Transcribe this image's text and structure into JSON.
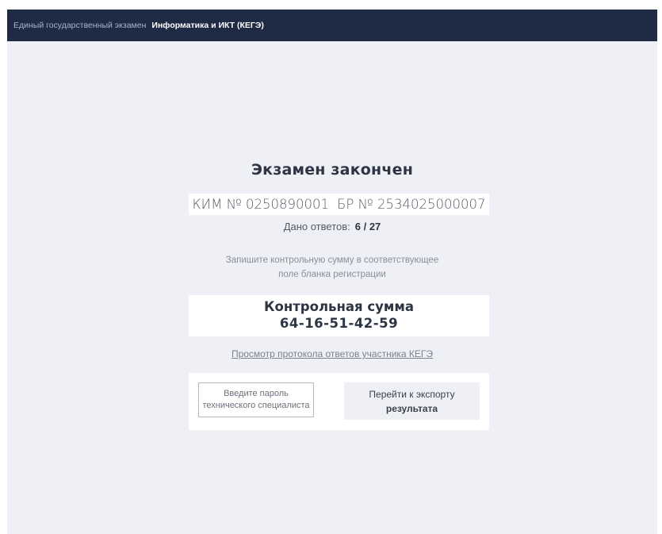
{
  "header": {
    "breadcrumb": "Единый государственный экзамен",
    "subject": "Информатика и ИКТ (КЕГЭ)"
  },
  "main": {
    "title": "Экзамен закончен",
    "kim": "КИМ № 0250890001",
    "br": "БР № 2534025000007",
    "answers_label": "Дано ответов:",
    "answers_count": "6 / 27",
    "instruction_line1": "Запишите контрольную сумму в соответствующее",
    "instruction_line2": "поле бланка регистрации",
    "checksum_label": "Контрольная сумма",
    "checksum_value": "64-16-51-42-59",
    "protocol_link": "Просмотр протокола ответов участника КЕГЭ",
    "password_placeholder": "Введите пароль технического специалиста",
    "export_line1": "Перейти к экспорту",
    "export_line2": "результата"
  },
  "colors": {
    "header_bg": "#1f2a44",
    "page_bg": "#eff0f5",
    "card_bg": "#ffffff"
  }
}
